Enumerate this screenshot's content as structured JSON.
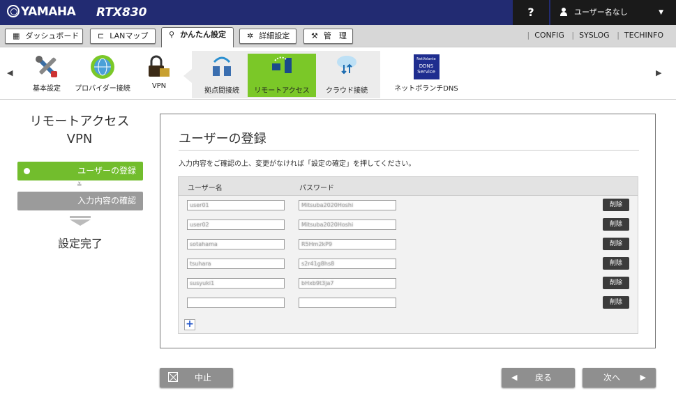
{
  "header": {
    "brand": "YAMAHA",
    "model": "RTX830",
    "help_label": "?",
    "user_label": "ユーザー名なし"
  },
  "tabs": [
    {
      "label": "ダッシュボード",
      "icon": "dashboard-icon"
    },
    {
      "label": "LANマップ",
      "icon": "lan-map-icon"
    },
    {
      "label": "かんたん設定",
      "icon": "wand-icon",
      "active": true
    },
    {
      "label": "詳細設定",
      "icon": "gear-icon"
    },
    {
      "label": "管　理",
      "icon": "wrench-icon"
    }
  ],
  "top_links": [
    "CONFIG",
    "SYSLOG",
    "TECHINFO"
  ],
  "feature_icons": {
    "basic": "基本設定",
    "provider": "プロバイダー接続",
    "vpn": "VPN",
    "site": "拠点間接続",
    "remote": "リモートアクセス",
    "cloud": "クラウド接続",
    "ddns_logo": [
      "NetVolante",
      "DDNS",
      "Service"
    ],
    "ddns": "ネットボランチDNS"
  },
  "wizard": {
    "title_line1": "リモートアクセス",
    "title_line2": "VPN",
    "step1": "ユーザーの登録",
    "step2": "入力内容の確認",
    "step3": "設定完了"
  },
  "main": {
    "heading": "ユーザーの登録",
    "description": "入力内容をご確認の上、変更がなければ「設定の確定」を押してください。",
    "col_user": "ユーザー名",
    "col_password": "パスワード",
    "delete_label": "削除",
    "add_label": "+",
    "rows": [
      {
        "user": "user01",
        "password": "Mitsuba2020Hoshi"
      },
      {
        "user": "user02",
        "password": "Mitsuba2020Hoshi"
      },
      {
        "user": "sotahama",
        "password": "R5Hm2kP9"
      },
      {
        "user": "tsuhara",
        "password": "s2r41g8hs8"
      },
      {
        "user": "susyuki1",
        "password": "bHxb9t3ja7"
      },
      {
        "user": "",
        "password": ""
      }
    ]
  },
  "buttons": {
    "cancel": "中止",
    "back": "戻る",
    "next": "次へ"
  },
  "colors": {
    "header_bg": "#222b72",
    "accent_green": "#72bd2d",
    "button_gray": "#8f8f8f"
  }
}
